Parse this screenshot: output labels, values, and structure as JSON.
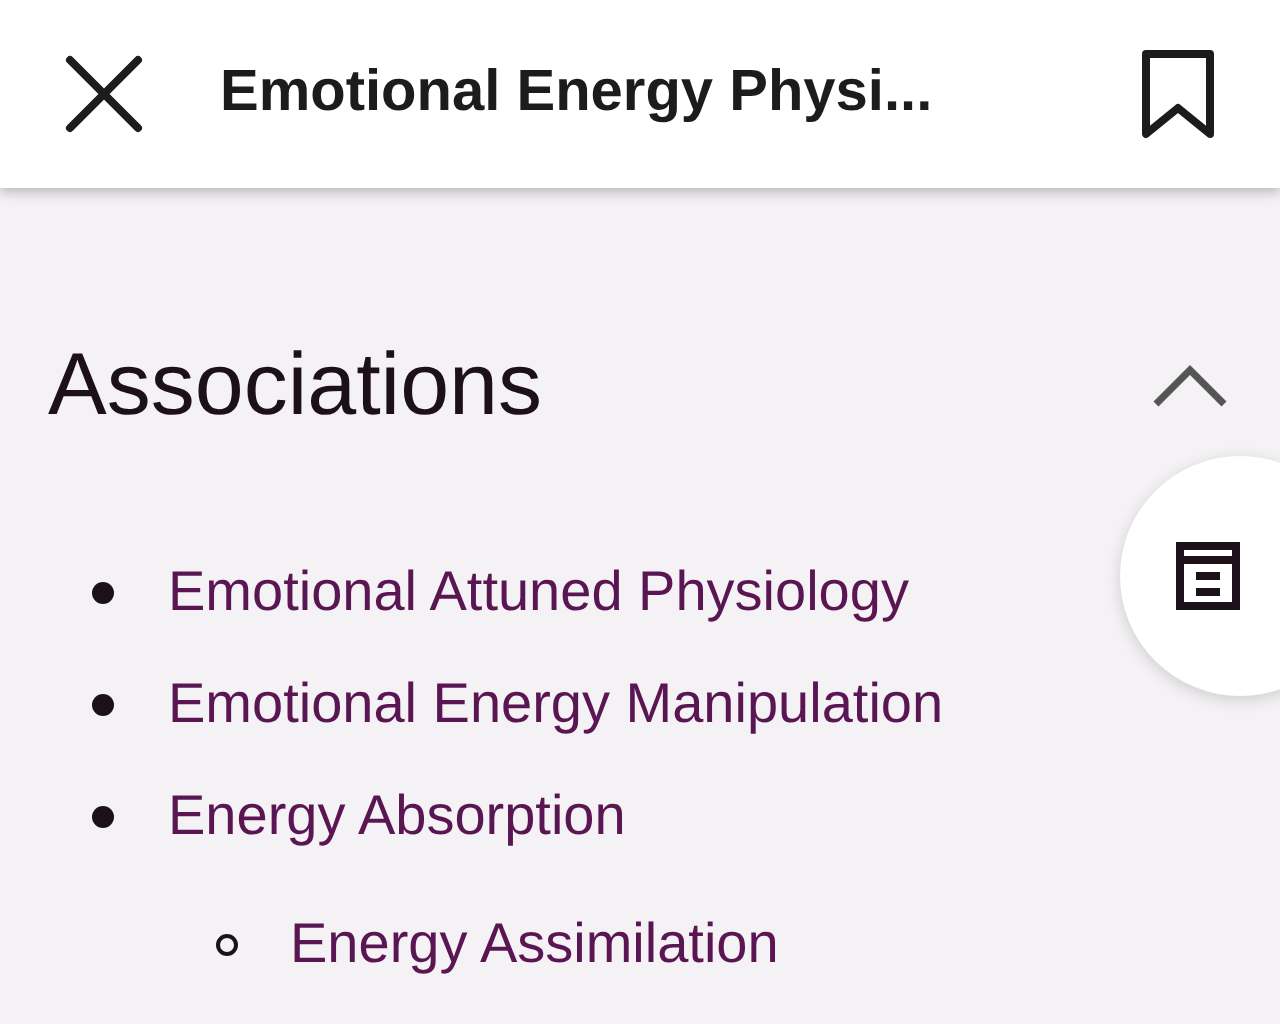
{
  "header": {
    "title": "Emotional Energy Physi..."
  },
  "section": {
    "title": "Associations",
    "expanded": true,
    "items": [
      {
        "label": "Emotional Attuned Physiology"
      },
      {
        "label": "Emotional Energy Manipulation"
      },
      {
        "label": "Energy Absorption",
        "children": [
          {
            "label": "Energy Assimilation"
          }
        ]
      }
    ]
  }
}
